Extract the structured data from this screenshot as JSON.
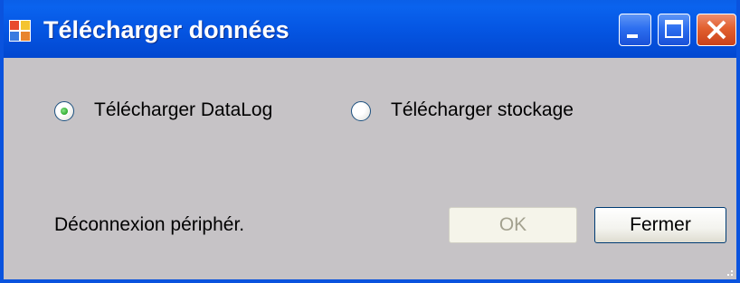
{
  "window": {
    "title": "Télécharger données",
    "controls": {
      "minimize_icon": "minimize-icon",
      "maximize_icon": "maximize-icon",
      "close_icon": "close-icon"
    }
  },
  "options": [
    {
      "label": "Télécharger DataLog",
      "selected": true
    },
    {
      "label": "Télécharger stockage",
      "selected": false
    }
  ],
  "status": {
    "text": "Déconnexion périphér."
  },
  "buttons": {
    "ok_label": "OK",
    "ok_enabled": false,
    "close_label": "Fermer"
  },
  "colors": {
    "titlebar": "#0555e2",
    "window_body": "#c6c3c6",
    "close_button": "#e2602f",
    "radio_selected": "#3fb83f"
  }
}
